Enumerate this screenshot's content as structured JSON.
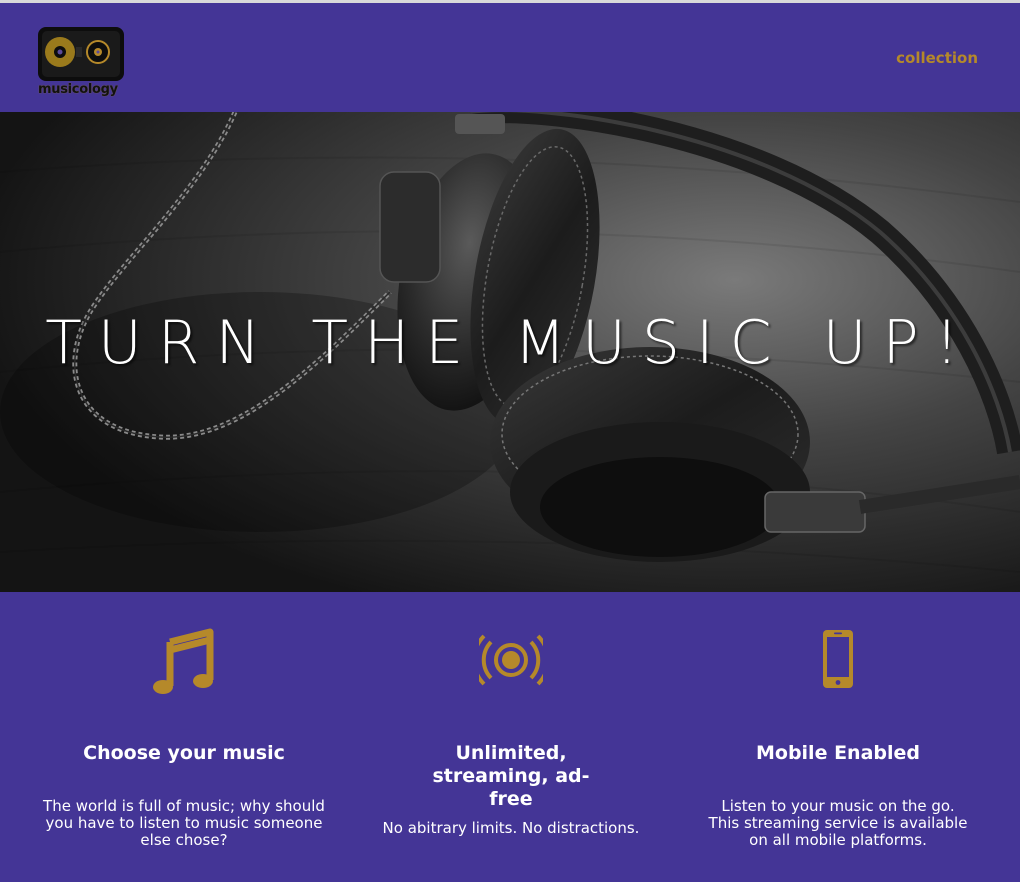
{
  "brand": {
    "logo_text": "musicology"
  },
  "nav": {
    "collection_label": "collection"
  },
  "hero": {
    "title": "TURN THE MUSIC UP!"
  },
  "features": [
    {
      "icon": "music-note-icon",
      "title": "Choose your music",
      "text": "The world is full of music; why should you have to listen to music someone else chose?"
    },
    {
      "icon": "broadcast-icon",
      "title": "Unlimited, streaming, ad-free",
      "text": "No abitrary limits. No distractions."
    },
    {
      "icon": "mobile-phone-icon",
      "title": "Mobile Enabled",
      "text": "Listen to your music on the go. This streaming service is available on all mobile platforms."
    }
  ],
  "colors": {
    "brand_purple": "#443596",
    "accent_gold": "#b5892a",
    "text_white": "#ffffff"
  }
}
